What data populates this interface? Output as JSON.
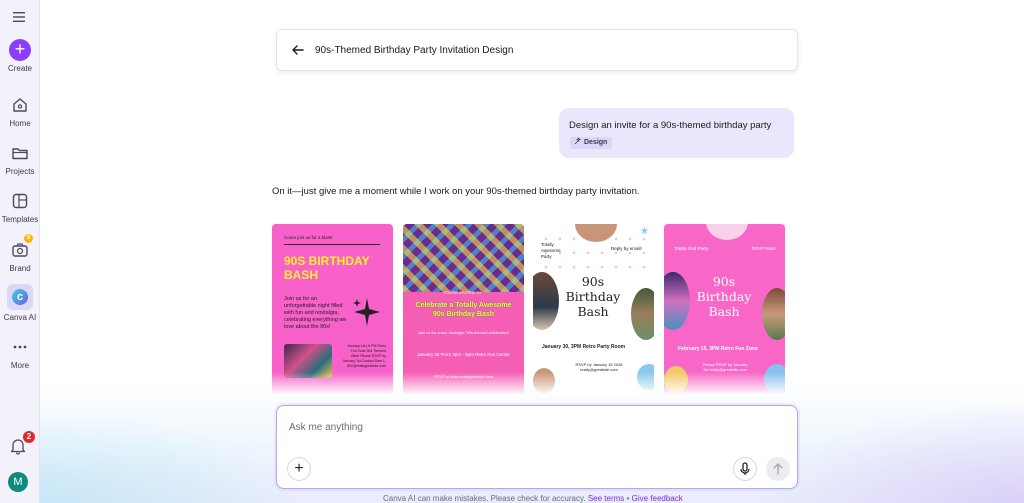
{
  "sidebar": {
    "items": [
      {
        "label": "Create",
        "icon": "plus-icon"
      },
      {
        "label": "Home",
        "icon": "home-icon"
      },
      {
        "label": "Projects",
        "icon": "folder-icon"
      },
      {
        "label": "Templates",
        "icon": "templates-icon"
      },
      {
        "label": "Brand",
        "icon": "brand-icon"
      },
      {
        "label": "Canva AI",
        "icon": "canva-ai-icon"
      },
      {
        "label": "More",
        "icon": "more-icon"
      }
    ],
    "notification_count": "2",
    "avatar_initial": "M"
  },
  "header": {
    "title": "90s-Themed Birthday Party Invitation Design"
  },
  "chat": {
    "user_message": "Design an invite for a 90s-themed birthday party",
    "user_chip": "Design",
    "assistant_message": "On it—just give me a moment while I work on your 90s-themed birthday party invitation."
  },
  "cards": {
    "card1": {
      "toptag": "Come join us for a blast!",
      "headline": "90S BIRTHDAY BASH",
      "body": "Join us for an unforgettable night filled with fun and nostalgia, celebrating everything we love about the 90s!",
      "info": "January 1st | 6 PM Retro Fun Zone 90s Themed Attire Please RSVP by January 1st Contact Sam 1-800@reallygreatsite.com"
    },
    "card2": {
      "tag": "YOU'RE INVITED TO",
      "headline": "Celebrate a Totally Awesome 90s Birthday Bash",
      "p1": "Join us for a rad, nostalgic '90s-themed celebration!",
      "p2": "January 30 From 3pm - 9pm Retro Fun Center",
      "p3": "RSVP at www.reallygreatsite.com"
    },
    "card3": {
      "tl": "Totally Awesome Party",
      "tr": "Reply by email!",
      "headline": "90s Birthday Bash",
      "date": "January 30, 3PM   Retro Party Room",
      "rsvp": "RSVP by January 15 2028 really@greatsite.com"
    },
    "card4": {
      "tl": "Totally Rad Party",
      "tr": "RSVP Now!",
      "headline": "90s Birthday Bash",
      "date": "February 15, 3PM  Retro Fun Zone",
      "rsvp": "Please RSVP by January 1st really@greatsite.com"
    }
  },
  "composer": {
    "placeholder": "Ask me anything"
  },
  "footer": {
    "disclaimer": "Canva AI can make mistakes. Please check for accuracy.",
    "terms_link": "See terms",
    "separator": "•",
    "feedback_link": "Give feedback"
  },
  "colors": {
    "accent": "#8b3dff",
    "bubble": "#ece6fc",
    "badge": "#e02a2a"
  }
}
